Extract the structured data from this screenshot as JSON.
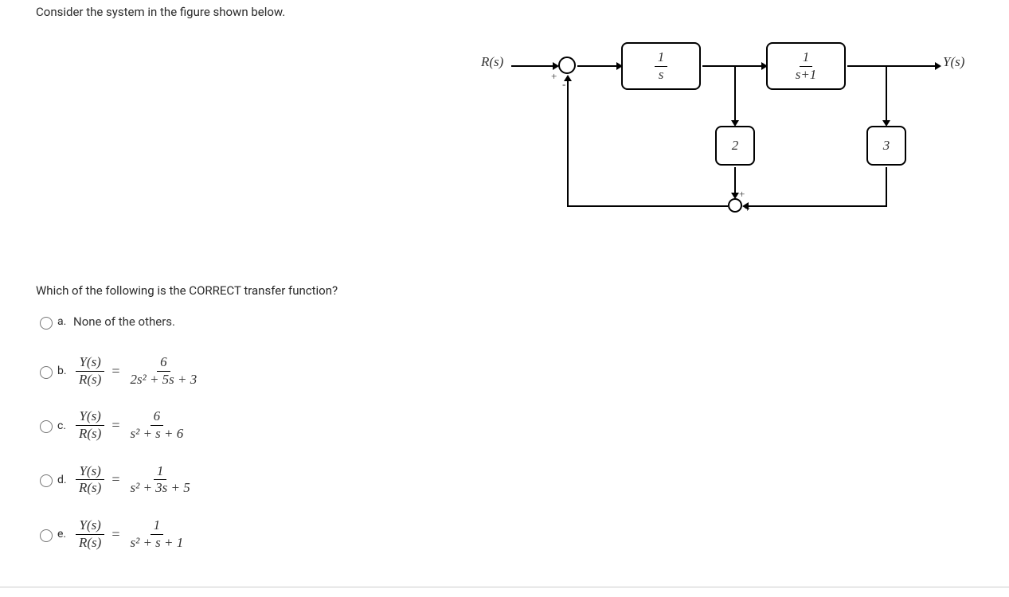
{
  "question": {
    "intro": "Consider the system in the figure shown below.",
    "prompt": "Which of the following is the CORRECT transfer function?"
  },
  "diagram": {
    "input": "R(s)",
    "output": "Y(s)",
    "block1_num": "1",
    "block1_den": "s",
    "block2_num": "1",
    "block2_den": "s+1",
    "fb1": "2",
    "fb2": "3",
    "sum1_plus": "+",
    "sum1_minus": "-",
    "sum2_plus1": "+",
    "sum2_plus2": "+"
  },
  "options": {
    "a": {
      "letter": "a.",
      "text": "None of the others."
    },
    "b": {
      "letter": "b.",
      "lhs_num": "Y(s)",
      "lhs_den": "R(s)",
      "rhs_num": "6",
      "rhs_den": "2s² + 5s + 3"
    },
    "c": {
      "letter": "c.",
      "lhs_num": "Y(s)",
      "lhs_den": "R(s)",
      "rhs_num": "6",
      "rhs_den": "s² + s + 6"
    },
    "d": {
      "letter": "d.",
      "lhs_num": "Y(s)",
      "lhs_den": "R(s)",
      "rhs_num": "1",
      "rhs_den": "s² + 3s + 5"
    },
    "e": {
      "letter": "e.",
      "lhs_num": "Y(s)",
      "lhs_den": "R(s)",
      "rhs_num": "1",
      "rhs_den": "s² + s + 1"
    }
  }
}
